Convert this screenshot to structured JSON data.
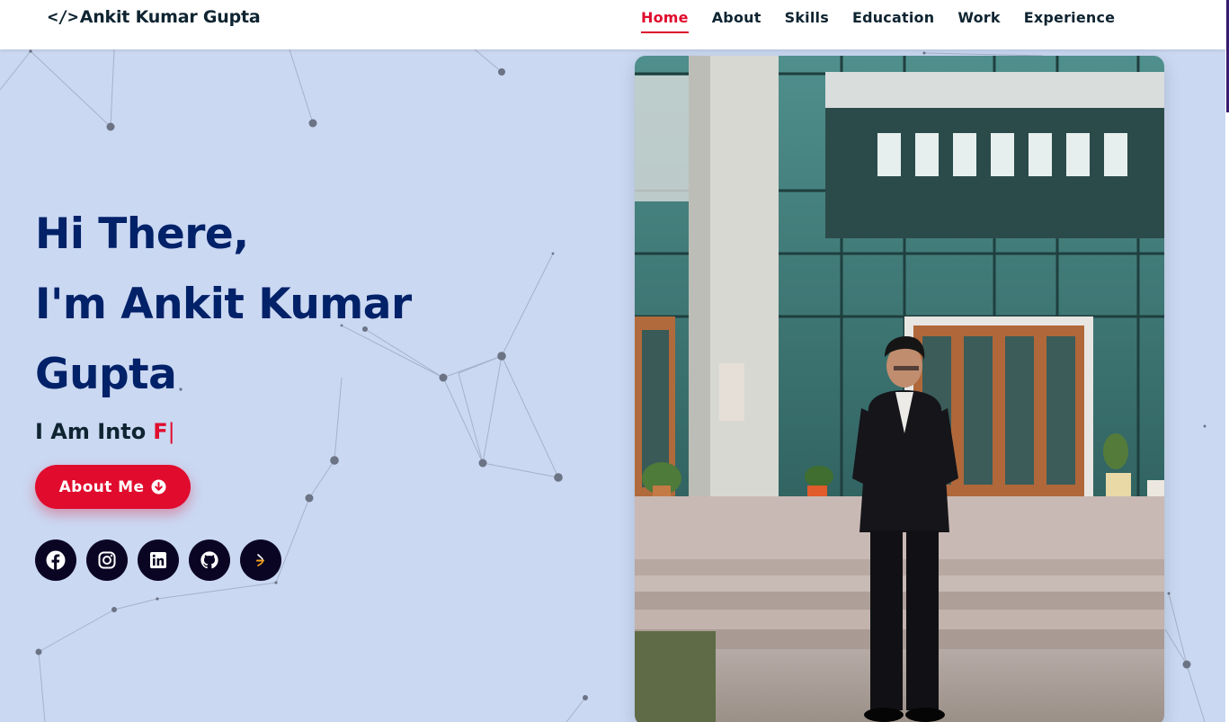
{
  "header": {
    "logo_icon": "</>",
    "logo_text": "Ankit Kumar Gupta",
    "nav": [
      {
        "label": "Home",
        "active": true
      },
      {
        "label": "About",
        "active": false
      },
      {
        "label": "Skills",
        "active": false
      },
      {
        "label": "Education",
        "active": false
      },
      {
        "label": "Work",
        "active": false
      },
      {
        "label": "Experience",
        "active": false
      }
    ]
  },
  "hero": {
    "title_line1": "Hi There,",
    "title_line2": "I'm Ankit Kumar",
    "title_line3": "Gupta",
    "typing_prefix": "I Am Into",
    "typing_text": "F",
    "typing_cursor": "|",
    "about_button": "About Me",
    "socials": [
      {
        "icon": "facebook-icon"
      },
      {
        "icon": "instagram-icon"
      },
      {
        "icon": "linkedin-icon"
      },
      {
        "icon": "github-icon"
      },
      {
        "icon": "codechef-icon"
      }
    ]
  },
  "photo": {
    "subject": "man-in-black-suit-standing-in-front-of-building"
  },
  "colors": {
    "background": "#cad8f2",
    "accent": "#e00b2d",
    "heading": "#012168",
    "text": "#0e2431",
    "social_bg": "#0b0524"
  }
}
